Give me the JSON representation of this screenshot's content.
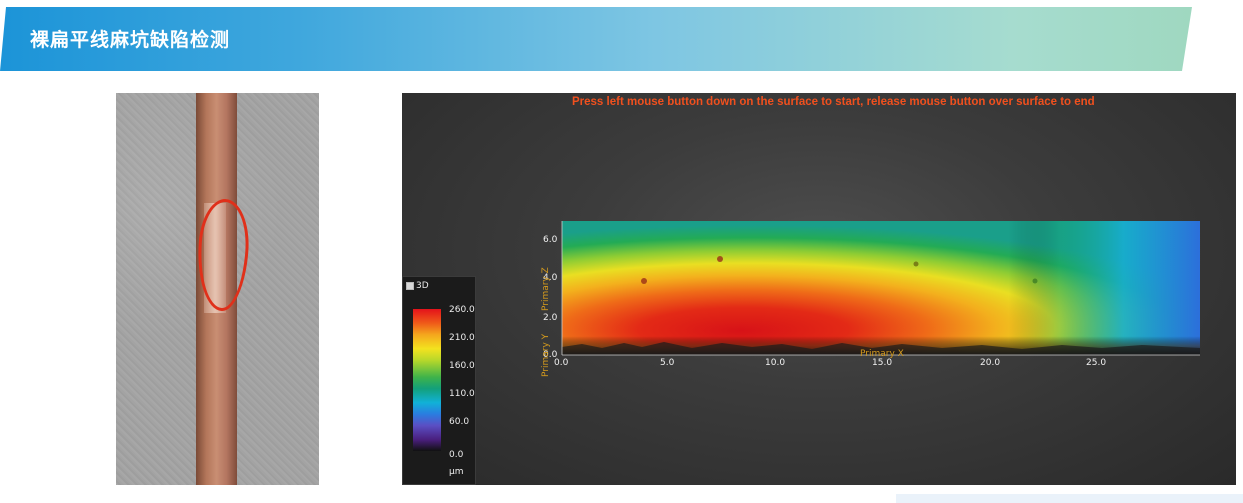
{
  "header": {
    "title": "裸扁平线麻坑缺陷检测"
  },
  "viewer": {
    "hint": "Press left mouse button down on the surface to start, release mouse button over surface to end",
    "legend": {
      "label": "3D",
      "ticks": [
        "260.0",
        "210.0",
        "160.0",
        "110.0",
        "60.0",
        "0.0"
      ],
      "unit": "μm"
    },
    "axes": {
      "x_ticks": [
        "0.0",
        "5.0",
        "10.0",
        "15.0",
        "20.0",
        "25.0"
      ],
      "z_ticks": [
        "0.0",
        "2.0",
        "4.0",
        "6.0"
      ],
      "primary_x": "Primary X",
      "primary_y": "Primary Y",
      "primary_z": "Primary Z"
    }
  }
}
